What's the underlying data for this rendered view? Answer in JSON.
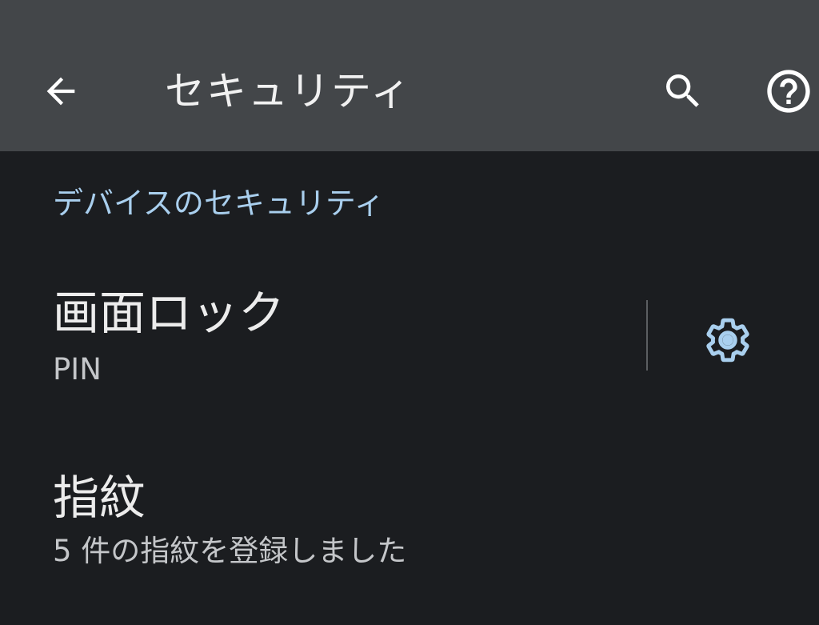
{
  "app_bar": {
    "title": "セキュリティ",
    "back_icon": "arrow-back-icon",
    "search_icon": "search-icon",
    "help_icon": "help-circle-icon"
  },
  "section": {
    "header": "デバイスのセキュリティ"
  },
  "preferences": [
    {
      "title": "画面ロック",
      "summary": "PIN",
      "settings_icon": "gear-icon"
    },
    {
      "title": "指紋",
      "summary": "5 件の指紋を登録しました"
    }
  ],
  "colors": {
    "app_bar_bg": "#434649",
    "background": "#1b1d20",
    "accent": "#a9cfee",
    "title_text": "#ececec",
    "summary_text": "#c4c6c9"
  }
}
